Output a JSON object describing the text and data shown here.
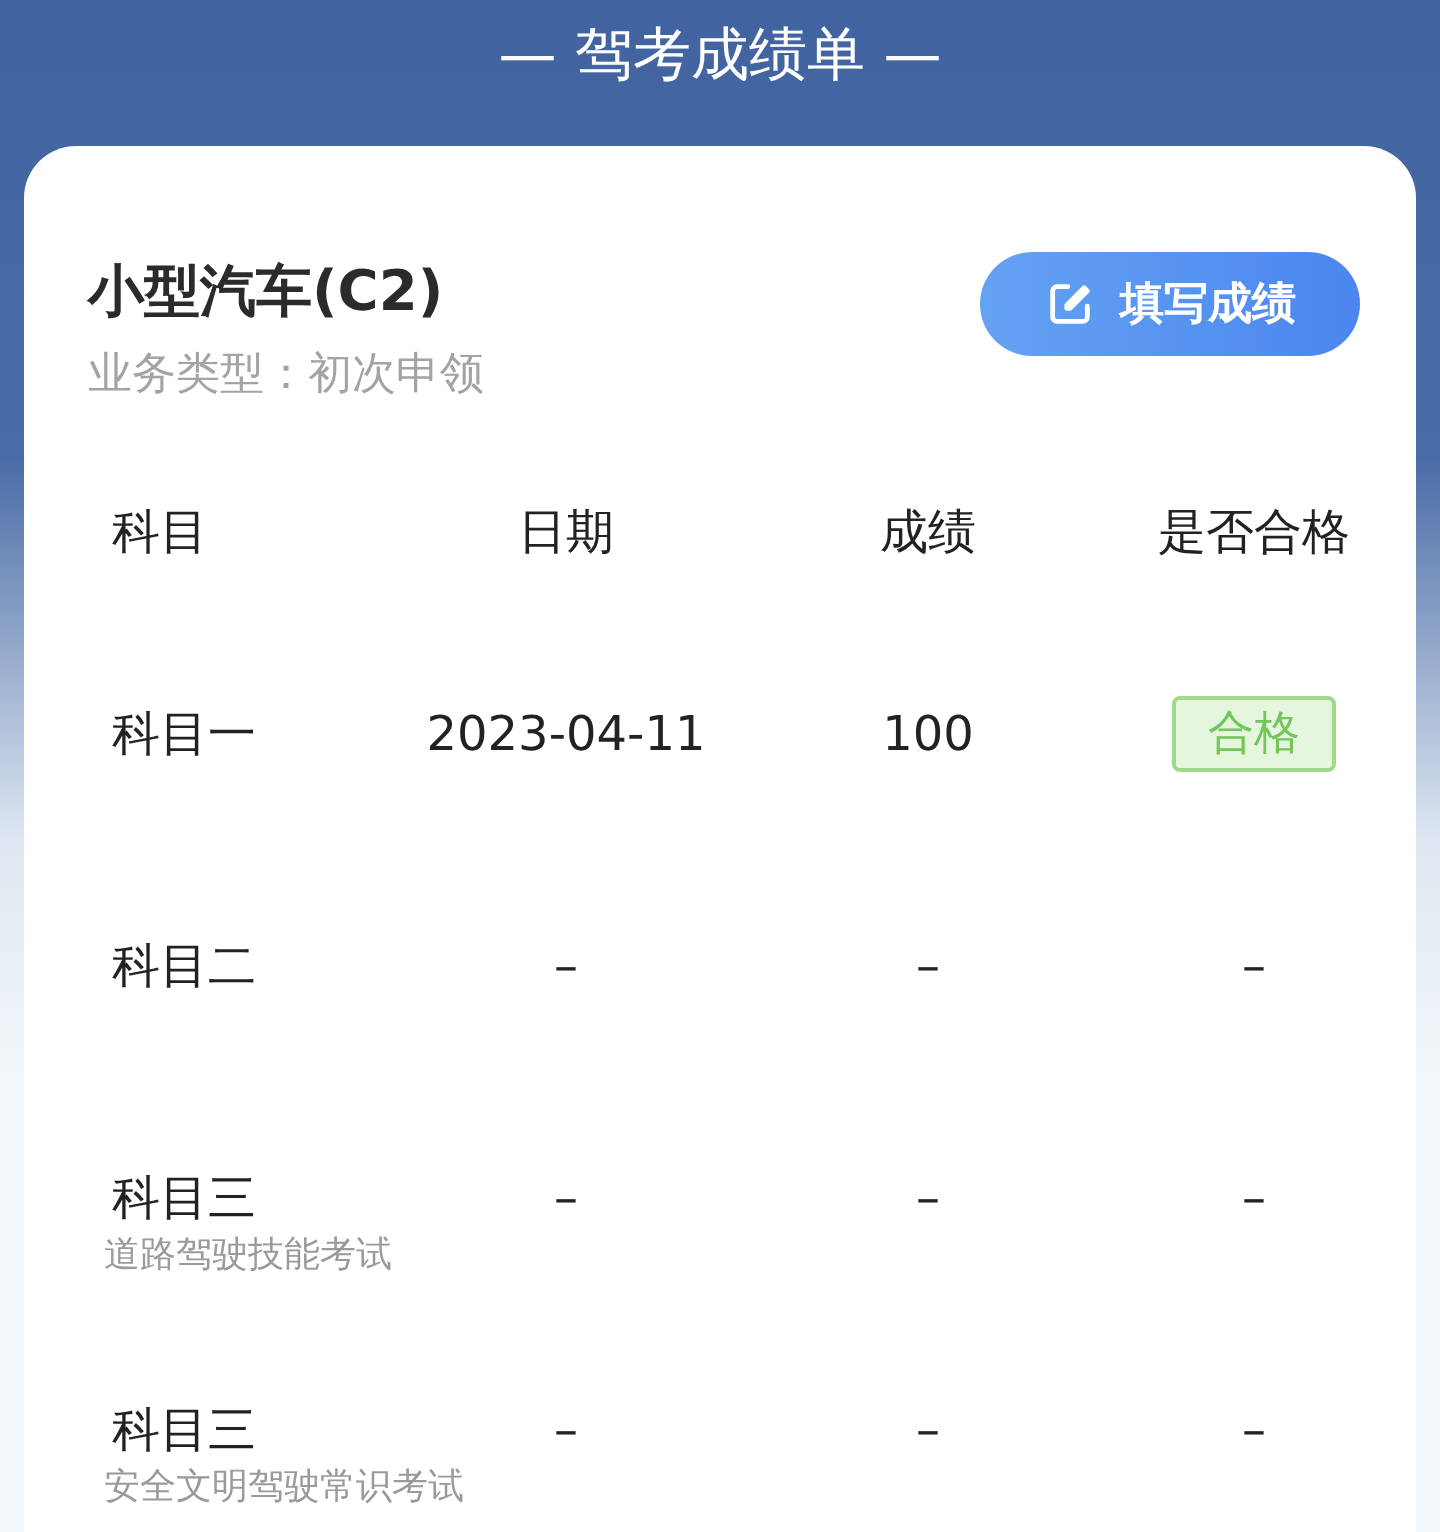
{
  "page_title": "— 驾考成绩单 —",
  "license": {
    "title": "小型汽车(C2)",
    "business_type": "业务类型：初次申领"
  },
  "fill_button": {
    "label": "填写成绩"
  },
  "table": {
    "columns": [
      "科目",
      "日期",
      "成绩",
      "是否合格"
    ],
    "rows": [
      {
        "subject": "科目一",
        "date": "2023-04-11",
        "score": "100",
        "result": {
          "kind": "badge",
          "text": "合格"
        }
      },
      {
        "subject": "科目二",
        "date": "–",
        "score": "–",
        "result": {
          "kind": "text",
          "text": "–"
        }
      },
      {
        "subject": "科目三",
        "note": "道路驾驶技能考试",
        "date": "–",
        "score": "–",
        "result": {
          "kind": "text",
          "text": "–"
        }
      },
      {
        "subject": "科目三",
        "note": "安全文明驾驶常识考试",
        "date": "–",
        "score": "–",
        "result": {
          "kind": "text",
          "text": "–"
        }
      }
    ]
  }
}
